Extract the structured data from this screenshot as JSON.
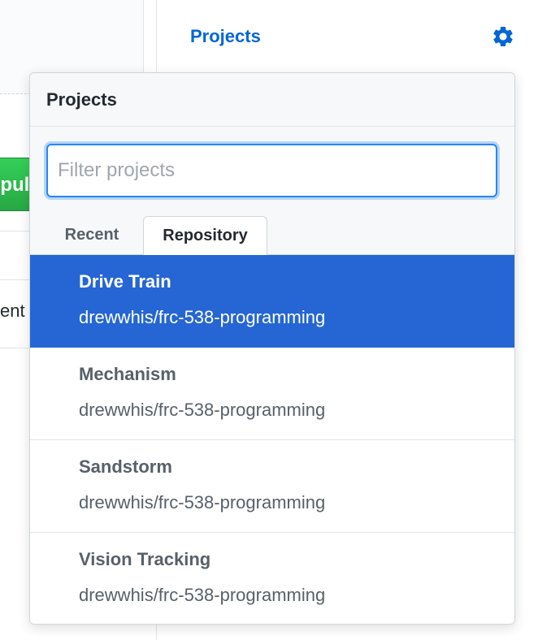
{
  "sidebar": {
    "title": "Projects",
    "settings_icon": "gear-icon",
    "accent_color": "#0366d6"
  },
  "background": {
    "button_partial_text": "pull",
    "text_partial": "ent"
  },
  "popover": {
    "title": "Projects",
    "filter": {
      "placeholder": "Filter projects",
      "value": ""
    },
    "tabs": [
      {
        "label": "Recent",
        "selected": false
      },
      {
        "label": "Repository",
        "selected": true
      }
    ],
    "items": [
      {
        "name": "Drive Train",
        "repo": "drewwhis/frc-538-programming",
        "selected": true
      },
      {
        "name": "Mechanism",
        "repo": "drewwhis/frc-538-programming",
        "selected": false
      },
      {
        "name": "Sandstorm",
        "repo": "drewwhis/frc-538-programming",
        "selected": false
      },
      {
        "name": "Vision Tracking",
        "repo": "drewwhis/frc-538-programming",
        "selected": false
      }
    ],
    "selected_color": "#2566d4"
  }
}
